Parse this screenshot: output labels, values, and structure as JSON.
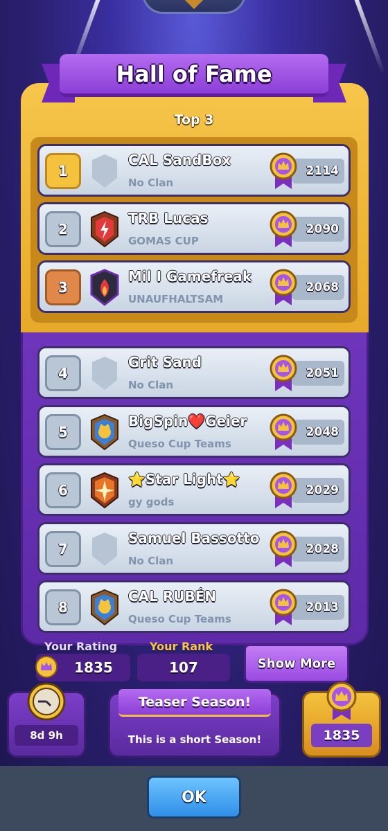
{
  "header": {
    "title": "Hall of Fame",
    "subtitle": "Top 3"
  },
  "colors": {
    "gold": "#f4c23c",
    "purple": "#7c3ec9",
    "row": "#e9eff6",
    "blue_button": "#2f8ee8"
  },
  "players": [
    {
      "rank": "1",
      "name": "CAL SandBox",
      "clan": "No Clan",
      "trophies": "2114",
      "badge": "empty-shield-icon",
      "rank_style": "gold"
    },
    {
      "rank": "2",
      "name": "TRB Lucas",
      "clan": "GOMAS CUP",
      "trophies": "2090",
      "badge": "lightning-clan-badge-icon",
      "rank_style": "silver"
    },
    {
      "rank": "3",
      "name": "Mil I Gamefreak",
      "clan": "UNAUFHALTSAM",
      "trophies": "2068",
      "badge": "fire-clan-badge-icon",
      "rank_style": "bronze"
    },
    {
      "rank": "4",
      "name": "Grit Sand",
      "clan": "No Clan",
      "trophies": "2051",
      "badge": "empty-shield-icon",
      "rank_style": "silver"
    },
    {
      "rank": "5",
      "name": "BigSpin❤️Geier",
      "clan": "Queso Cup Teams",
      "trophies": "2048",
      "badge": "knight-clan-badge-icon",
      "rank_style": "silver"
    },
    {
      "rank": "6",
      "name": "⭐Star Light⭐",
      "clan": "gy gods",
      "trophies": "2029",
      "badge": "star-clan-badge-icon",
      "rank_style": "silver"
    },
    {
      "rank": "7",
      "name": "Samuel Bassotto",
      "clan": "No Clan",
      "trophies": "2028",
      "badge": "empty-shield-icon",
      "rank_style": "silver"
    },
    {
      "rank": "8",
      "name": "CAL RUBÉN",
      "clan": "Queso Cup Teams",
      "trophies": "2013",
      "badge": "knight-clan-badge-icon",
      "rank_style": "silver"
    }
  ],
  "stats": {
    "rating_label": "Your Rating",
    "rating_value": "1835",
    "rank_label": "Your Rank",
    "rank_value": "107",
    "show_more": "Show More"
  },
  "season": {
    "timer": "8d 9h",
    "title": "Teaser Season!",
    "description": "This is a short Season!",
    "rating": "1835"
  },
  "footer": {
    "ok_label": "OK"
  }
}
